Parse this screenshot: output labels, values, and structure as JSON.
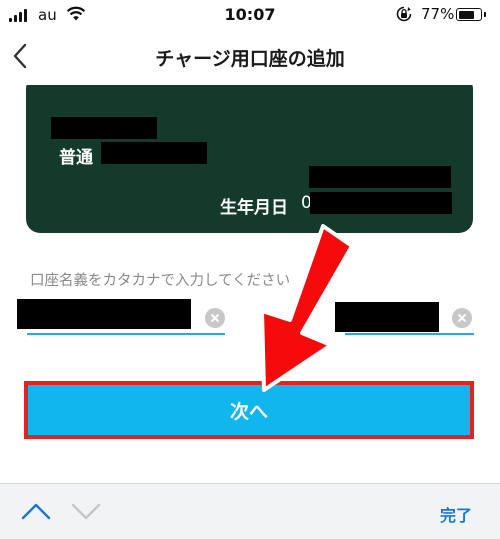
{
  "status_bar": {
    "carrier": "au",
    "time": "10:07",
    "battery_percent": "77%",
    "battery_level": 0.77,
    "icons": [
      "signal-icon",
      "wifi-icon",
      "orientation-lock-icon",
      "battery-icon"
    ]
  },
  "nav": {
    "title": "チャージ用口座の追加",
    "back_icon": "chevron-left-icon"
  },
  "card": {
    "account_type_label": "普通",
    "birthdate_label": "生年月日",
    "birthdate_value_prefix": "0",
    "background_color": "#133a2a"
  },
  "form": {
    "name_hint": "口座名義をカタカナで入力してください",
    "last_name_value": "",
    "first_name_value": ""
  },
  "actions": {
    "next_label": "次へ",
    "button_color": "#12b6ef",
    "highlight_color": "#e02424"
  },
  "keyboard_toolbar": {
    "done_label": "完了"
  }
}
